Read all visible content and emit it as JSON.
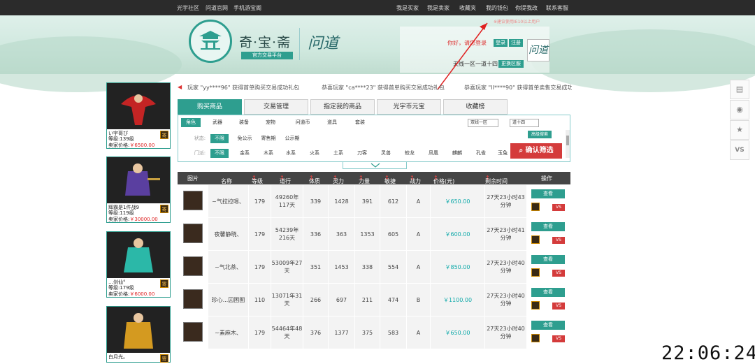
{
  "topbar": {
    "left": [
      "光宇社区",
      "问道官网",
      "手机游宝阁"
    ],
    "right": [
      "我是买家",
      "我是卖家",
      "收藏夹",
      "我的钱包",
      "你提我改",
      "联系客服"
    ]
  },
  "header": {
    "brand": "奇·宝·斋",
    "brand_sub": "官方交易平台",
    "signature": "问道",
    "notice": "※建议使用IE10以上用户",
    "hello": "你好，请您登录",
    "login": "登录",
    "register": "注册",
    "server": "天线一区一道十四",
    "switch": "更换区服"
  },
  "marquee": [
    "玩家 \"yy****96\" 获得首单购买交易成功礼包",
    "恭喜玩家 \"ca****23\" 获得首单购买交易成功礼包",
    "恭喜玩家 \"II****90\" 获得首单卖售交易成功"
  ],
  "tabs": [
    "购买商品",
    "交易管理",
    "指定我的商品",
    "光宇币元宝",
    "收藏榜"
  ],
  "categories": [
    "角色",
    "武器",
    "装备",
    "宠物",
    "问道币",
    "道具",
    "套装"
  ],
  "filters": {
    "state_label": "状态:",
    "states": [
      "不限",
      "免公示",
      "寄售期",
      "公示期"
    ],
    "school_label": "门派:",
    "schools": [
      "不限",
      "金系",
      "木系",
      "水系",
      "火系",
      "土系",
      "刀客",
      "灵兽",
      "蛟龙",
      "凤凰",
      "麒麟",
      "孔雀",
      "玉兔"
    ],
    "server_select": "双线一区",
    "sub_select": "道十四",
    "advanced": "高级搜索",
    "confirm": "确认筛选"
  },
  "table": {
    "headers": [
      "图片",
      "名称",
      "等级",
      "道行",
      "体质",
      "灵力",
      "力量",
      "敏捷",
      "战力",
      "价格(元)",
      "剩余时间",
      "操作"
    ],
    "rows": [
      {
        "name": "~气拉拉嗯、",
        "level": "179",
        "daoxing": "49260年117天",
        "tizhi": "339",
        "lingli": "1428",
        "liliang": "391",
        "minjie": "612",
        "zhanli": "A",
        "price": "￥650.00",
        "time": "27天23小时43分钟",
        "view": "查看",
        "vs": "VS"
      },
      {
        "name": "夜馨静晓、",
        "level": "179",
        "daoxing": "54239年216天",
        "tizhi": "336",
        "lingli": "363",
        "liliang": "1353",
        "minjie": "605",
        "zhanli": "A",
        "price": "￥600.00",
        "time": "27天23小时41分钟",
        "view": "查看",
        "vs": "VS"
      },
      {
        "name": "~气北茶、",
        "level": "179",
        "daoxing": "53009年27天",
        "tizhi": "351",
        "lingli": "1453",
        "liliang": "338",
        "minjie": "554",
        "zhanli": "A",
        "price": "￥850.00",
        "time": "27天23小时40分钟",
        "view": "查看",
        "vs": "VS"
      },
      {
        "name": "珍心...囚困囿",
        "level": "110",
        "daoxing": "13071年31天",
        "tizhi": "266",
        "lingli": "697",
        "liliang": "211",
        "minjie": "474",
        "zhanli": "B",
        "price": "￥1100.00",
        "time": "27天23小时40分钟",
        "view": "查看",
        "vs": "VS"
      },
      {
        "name": "~素麻木、",
        "level": "179",
        "daoxing": "54464年48天",
        "tizhi": "376",
        "lingli": "1377",
        "liliang": "375",
        "minjie": "583",
        "zhanli": "A",
        "price": "￥650.00",
        "time": "27天23小时40分钟",
        "view": "查看",
        "vs": "VS"
      }
    ]
  },
  "sidebar": [
    {
      "name": "い宇哥ぴ",
      "level": "等级:139级",
      "price_label": "卖家价格:",
      "price": "￥6500.00",
      "ji": "寄"
    },
    {
      "name": "辉霸是1件战9",
      "level": "等级:119级",
      "price_label": "卖家价格:",
      "price": "￥30000.00",
      "ji": "寄"
    },
    {
      "name": "…剑仙°",
      "level": "等级:179级",
      "price_label": "卖家价格:",
      "price": "￥6000.00",
      "ji": "寄"
    },
    {
      "name": "白月光。",
      "level": "",
      "price_label": "",
      "price": "",
      "ji": "寄"
    }
  ],
  "right_tools": {
    "vs": "VS"
  },
  "clock": "22:06:24",
  "colors": {
    "accent": "#2e9e8f",
    "danger": "#d43b3b",
    "header_bar": "#2b2b2b"
  }
}
